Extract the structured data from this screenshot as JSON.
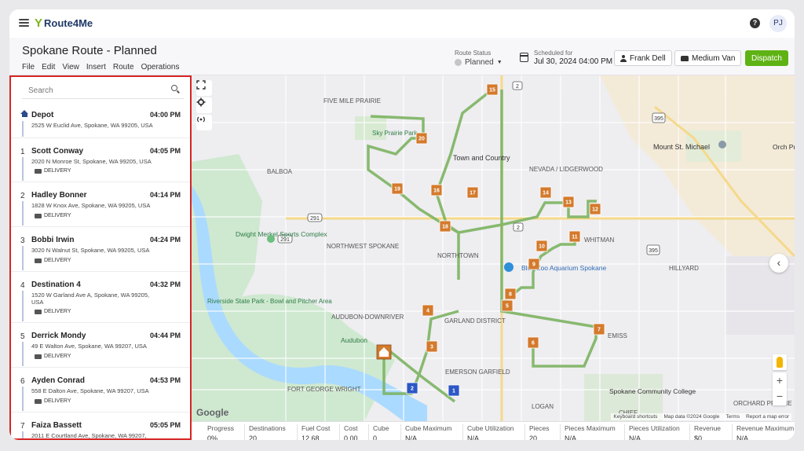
{
  "app": {
    "brand_name": "Route4Me",
    "user_initials": "PJ"
  },
  "header": {
    "route_title": "Spokane Route - Planned",
    "menu": [
      "File",
      "Edit",
      "View",
      "Insert",
      "Route",
      "Operations"
    ],
    "route_status_label": "Route Status",
    "route_status_value": "Planned",
    "scheduled_label": "Scheduled for",
    "scheduled_value": "Jul 30, 2024 04:00 PM",
    "driver_label": "Frank Dell",
    "vehicle_label": "Medium Van",
    "dispatch_label": "Dispatch"
  },
  "sidebar": {
    "search_placeholder": "Search",
    "stops": [
      {
        "num": "",
        "name": "Depot",
        "time": "04:00 PM",
        "address": "2525 W Euclid Ave, Spokane, WA 99205, USA",
        "badge": ""
      },
      {
        "num": "1",
        "name": "Scott Conway",
        "time": "04:05 PM",
        "address": "2020 N Monroe St, Spokane, WA 99205, USA",
        "badge": "DELIVERY"
      },
      {
        "num": "2",
        "name": "Hadley Bonner",
        "time": "04:14 PM",
        "address": "1828 W Knox Ave, Spokane, WA 99205, USA",
        "badge": "DELIVERY"
      },
      {
        "num": "3",
        "name": "Bobbi Irwin",
        "time": "04:24 PM",
        "address": "3020 N Walnut St, Spokane, WA 99205, USA",
        "badge": "DELIVERY"
      },
      {
        "num": "4",
        "name": "Destination 4",
        "time": "04:32 PM",
        "address": "1520 W Garland Ave A, Spokane, WA 99205, USA",
        "badge": "DELIVERY"
      },
      {
        "num": "5",
        "name": "Derrick Mondy",
        "time": "04:44 PM",
        "address": "49 E Walton Ave, Spokane, WA 99207, USA",
        "badge": "DELIVERY"
      },
      {
        "num": "6",
        "name": "Ayden Conrad",
        "time": "04:53 PM",
        "address": "558 E Dalton Ave, Spokane, WA 99207, USA",
        "badge": "DELIVERY"
      },
      {
        "num": "7",
        "name": "Faiza Bassett",
        "time": "05:05 PM",
        "address": "2011 E Courtland Ave, Spokane, WA 99207,",
        "badge": ""
      }
    ]
  },
  "map": {
    "labels": {
      "five_mile_prairie": "FIVE MILE PRAIRIE",
      "sky_prairie": "Sky Prairie Park",
      "town_country": "Town and Country",
      "nevada_lidgerwood": "NEVADA / LIDGERWOOD",
      "mount_st_michael": "Mount St. Michael",
      "balboa": "BALBOA",
      "dwight_merkel": "Dwight Merkel Sports Complex",
      "northwest_spokane": "NORTHWEST SPOKANE",
      "northtown": "NORTHTOWN",
      "whitman": "WHITMAN",
      "hillyard": "HILLYARD",
      "blue_zoo": "Blue Zoo Aquarium Spokane",
      "riverside_state_park": "Riverside State Park - Bowl and Pitcher Area",
      "audubon_downriver": "AUDUBON-DOWNRIVER",
      "garland_district": "GARLAND DISTRICT",
      "emerson_garfield": "EMERSON GARFIELD",
      "fort_george_wright": "FORT GEORGE WRIGHT",
      "logan": "LOGAN",
      "spokane_cc": "Spokane Community College",
      "chief": "CHIEF",
      "orchard_prairie": "ORCHARD PRAIRIE",
      "orch": "Orch Prai",
      "audubon": "Audubon",
      "emiss": "EMISS"
    },
    "highway_shields": [
      "2",
      "291",
      "395",
      "395",
      "2",
      "291"
    ],
    "markers": [
      "15",
      "20",
      "19",
      "16",
      "17",
      "14",
      "13",
      "12",
      "18",
      "11",
      "10",
      "9",
      "8",
      "5",
      "4",
      "3",
      "7",
      "6",
      "2",
      "1"
    ],
    "google_label": "Google",
    "attribution": [
      "Keyboard shortcuts",
      "Map data ©2024 Google",
      "Terms",
      "Report a map error"
    ]
  },
  "stats": [
    {
      "label": "Progress",
      "value": "0%"
    },
    {
      "label": "Destinations",
      "value": "20"
    },
    {
      "label": "Fuel Cost",
      "value": "12.68"
    },
    {
      "label": "Cost",
      "value": "0.00"
    },
    {
      "label": "Cube",
      "value": "0"
    },
    {
      "label": "Cube Maximum",
      "value": "N/A"
    },
    {
      "label": "Cube Utilization",
      "value": "N/A"
    },
    {
      "label": "Pieces",
      "value": "20"
    },
    {
      "label": "Pieces Maximum",
      "value": "N/A"
    },
    {
      "label": "Pieces Utilization",
      "value": "N/A"
    },
    {
      "label": "Revenue",
      "value": "$0"
    },
    {
      "label": "Revenue Maximum",
      "value": "N/A"
    }
  ],
  "colors": {
    "accent": "#5fb214",
    "highlight_border": "#d72424",
    "route_line": "#7cb462",
    "marker": "#d47a2c",
    "depot_marker": "#2c57c5"
  }
}
